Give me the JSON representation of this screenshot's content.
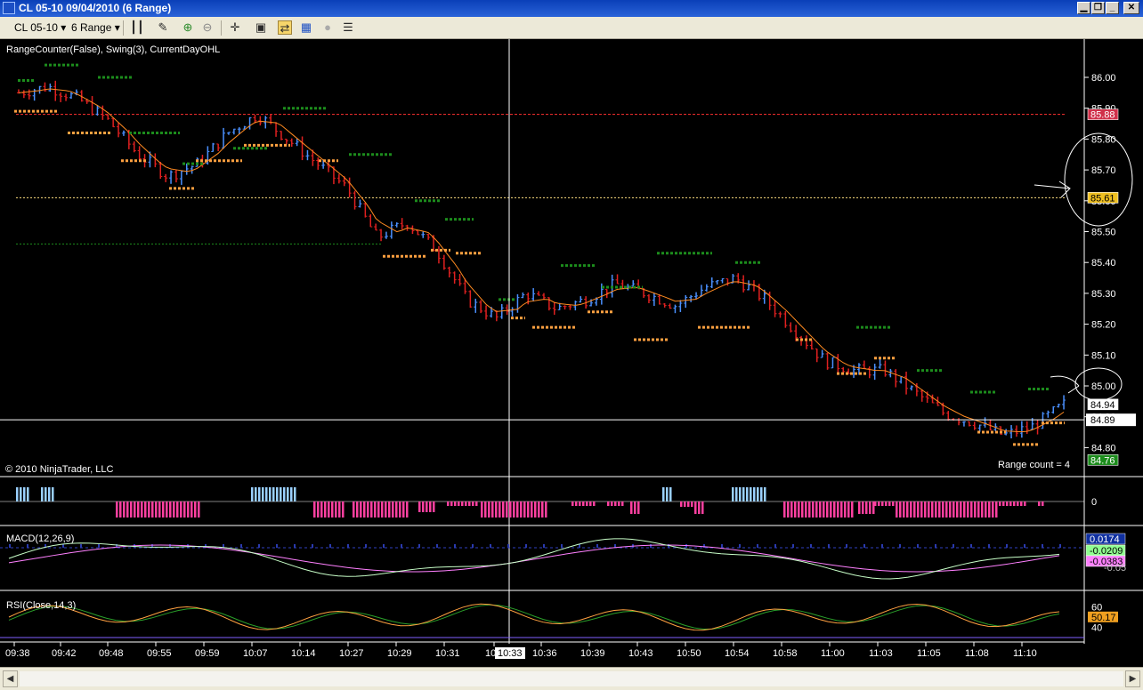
{
  "window": {
    "title": "CL 05-10  09/04/2010 (6 Range)",
    "buttons": [
      "restore-down",
      "maximize",
      "close"
    ]
  },
  "toolbar": {
    "instrument": "CL 05-10",
    "period": "6 Range",
    "icons": [
      "bar-chart-icon",
      "draw-pen-icon",
      "zoom-in-icon",
      "zoom-out-icon",
      "crosshair-icon",
      "data-box-icon",
      "indicators-icon",
      "strategies-icon",
      "properties-icon",
      "more-icon"
    ]
  },
  "panels": {
    "price": {
      "indicators_label": "RangeCounter(False), Swing(3), CurrentDayOHL",
      "copyright": "© 2010 NinjaTrader, LLC",
      "range_counter": "Range count = 4",
      "axis_ticks": [
        "86.00",
        "85.90",
        "85.80",
        "85.70",
        "85.60",
        "85.50",
        "85.40",
        "85.30",
        "85.20",
        "85.10",
        "85.00",
        "84.90",
        "84.80"
      ],
      "markers": {
        "high": "85.88",
        "current_day_open": "85.61",
        "last_close": "84.94",
        "cursor_price": "84.89",
        "low": "84.76"
      }
    },
    "histogram": {
      "axis_ticks": [
        "0"
      ]
    },
    "macd": {
      "label": "MACD(12,26,9)",
      "values": [
        "0.0174",
        "-0.0209",
        "-0.0383"
      ],
      "axis_ticks": [
        "-0.05"
      ]
    },
    "rsi": {
      "label": "RSI(Close,14,3)",
      "values": [
        "50.17"
      ],
      "axis_ticks": [
        "60",
        "40"
      ]
    }
  },
  "x_axis": {
    "labels": [
      "09:38",
      "09:42",
      "09:48",
      "09:55",
      "09:59",
      "10:07",
      "10:14",
      "10:27",
      "10:29",
      "10:31",
      "10:33",
      "10:36",
      "10:39",
      "10:43",
      "10:50",
      "10:54",
      "10:58",
      "11:00",
      "11:03",
      "11:05",
      "11:08",
      "11:10"
    ],
    "cursor_time": "10:33"
  },
  "colors": {
    "background": "#000000",
    "up_bar": "#4a90ff",
    "down_bar": "#e02020",
    "swing_high": "#1c8c1c",
    "swing_low": "#ffa040",
    "sma": "#ff8a20",
    "high_line": "#ff3030",
    "open_line": "#ffe080",
    "low_line": "#1c8c1c",
    "hist_pos": "#9ad0ff",
    "hist_neg": "#ff40a0",
    "macd_line": "#c8ffc8",
    "macd_avg": "#ff80ff",
    "rsi_line": "#ffa040"
  },
  "chart_data": {
    "type": "candlestick",
    "title": "",
    "y_range": [
      84.74,
      86.05
    ],
    "x": [
      "09:38",
      "09:42",
      "09:48",
      "09:55",
      "09:59",
      "10:07",
      "10:14",
      "10:27",
      "10:29",
      "10:31",
      "10:33",
      "10:36",
      "10:39",
      "10:43",
      "10:50",
      "10:54",
      "10:58",
      "11:00",
      "11:03",
      "11:05",
      "11:08",
      "11:10"
    ],
    "close_path": [
      85.95,
      85.97,
      85.93,
      85.86,
      85.75,
      85.68,
      85.72,
      85.82,
      85.88,
      85.8,
      85.72,
      85.64,
      85.48,
      85.53,
      85.44,
      85.28,
      85.22,
      85.3,
      85.25,
      85.28,
      85.33,
      85.3,
      85.26,
      85.32,
      85.35,
      85.28,
      85.18,
      85.08,
      85.05,
      85.05,
      84.98,
      84.91,
      84.88,
      84.84,
      84.87,
      84.94
    ],
    "levels": {
      "high": 85.88,
      "open": 85.61,
      "low": 84.76,
      "prev_support": 85.46
    },
    "rsi_range": [
      30,
      70
    ],
    "rsi_last": 50.17,
    "macd_last": [
      0.0174,
      -0.0209,
      -0.0383
    ]
  }
}
